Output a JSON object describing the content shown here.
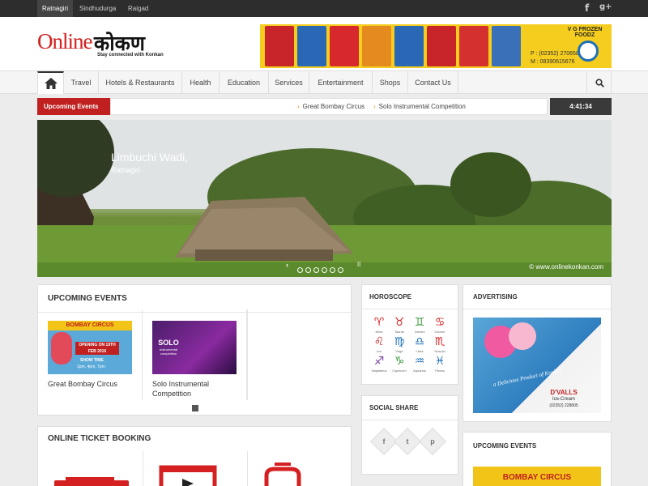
{
  "topbar": {
    "cities": [
      "Ratnagiri",
      "Sindhudurga",
      "Raigad"
    ],
    "active_city": "Ratnagiri",
    "social": {
      "facebook": "f",
      "google_plus": "g+"
    }
  },
  "header": {
    "logo_online": "Online",
    "logo_konkan": "कोकण",
    "logo_tagline": "Stay connected with Konkan",
    "ad": {
      "brand": "V G FROZEN FOODZ",
      "phone_p": "P : (02352) 270658",
      "phone_m": "M : 08390615676"
    }
  },
  "nav": {
    "items": [
      "Travel",
      "Hotels & Restaurants",
      "Health",
      "Education",
      "Services",
      "Entertainment",
      "Shops",
      "Contact Us"
    ]
  },
  "ticker": {
    "label": "Upcoming Events",
    "items": [
      "Great Bombay Circus",
      "Solo Instrumental Competition"
    ],
    "clock": "4:41:34"
  },
  "slider": {
    "title": "Limbuchi Wadi,",
    "subtitle": "Ratnagiri",
    "credit": "© www.onlinekonkan.com",
    "slide_count": 7,
    "active_slide": 1
  },
  "upcoming_events": {
    "title": "UPCOMING EVENTS",
    "events": [
      {
        "name": "Great Bombay Circus",
        "poster_title": "BOMBAY CIRCUS",
        "poster_date": "OPENING ON 19TH FEB 2016",
        "poster_show": "SHOW TIME",
        "poster_times": "1pm, 4pm, 7pm"
      },
      {
        "name": "Solo Instrumental Competition",
        "poster_title": "SOLO",
        "poster_sub": "Instrumental competition"
      }
    ]
  },
  "horoscope": {
    "title": "HOROSCOPE",
    "signs": [
      "♈",
      "♉",
      "♊",
      "♋",
      "♌",
      "♍",
      "♎",
      "♏",
      "♐",
      "♑",
      "♒",
      "♓"
    ],
    "labels": [
      "Aries",
      "Taurus",
      "Gemini",
      "Cancer",
      "Leo",
      "Virgo",
      "Libra",
      "Scorpio",
      "Sagittarius",
      "Capricorn",
      "Aquarius",
      "Pisces"
    ],
    "colors": {
      "red": "#d42020",
      "yellow": "#f1b800",
      "green": "#3a9a3a",
      "blue": "#1e6fb8",
      "pink": "#d4408a",
      "purple": "#7a3fa0"
    }
  },
  "social_share": {
    "title": "SOCIAL SHARE",
    "buttons": [
      "f",
      "t",
      "p"
    ]
  },
  "advertising": {
    "title": "ADVERTISING",
    "brand": "D'VALLS",
    "product": "Ice-Cream",
    "slogan": "a Delicious Product of Konkan",
    "phone": "(02352) 228805"
  },
  "ticket_booking": {
    "title": "ONLINE TICKET BOOKING"
  },
  "upcoming_events_side": {
    "title": "UPCOMING EVENTS",
    "poster_title": "BOMBAY CIRCUS"
  },
  "colors": {
    "accent_red": "#c0201f",
    "dark_bar": "#2d2d2d",
    "page_bg": "#ececec"
  }
}
